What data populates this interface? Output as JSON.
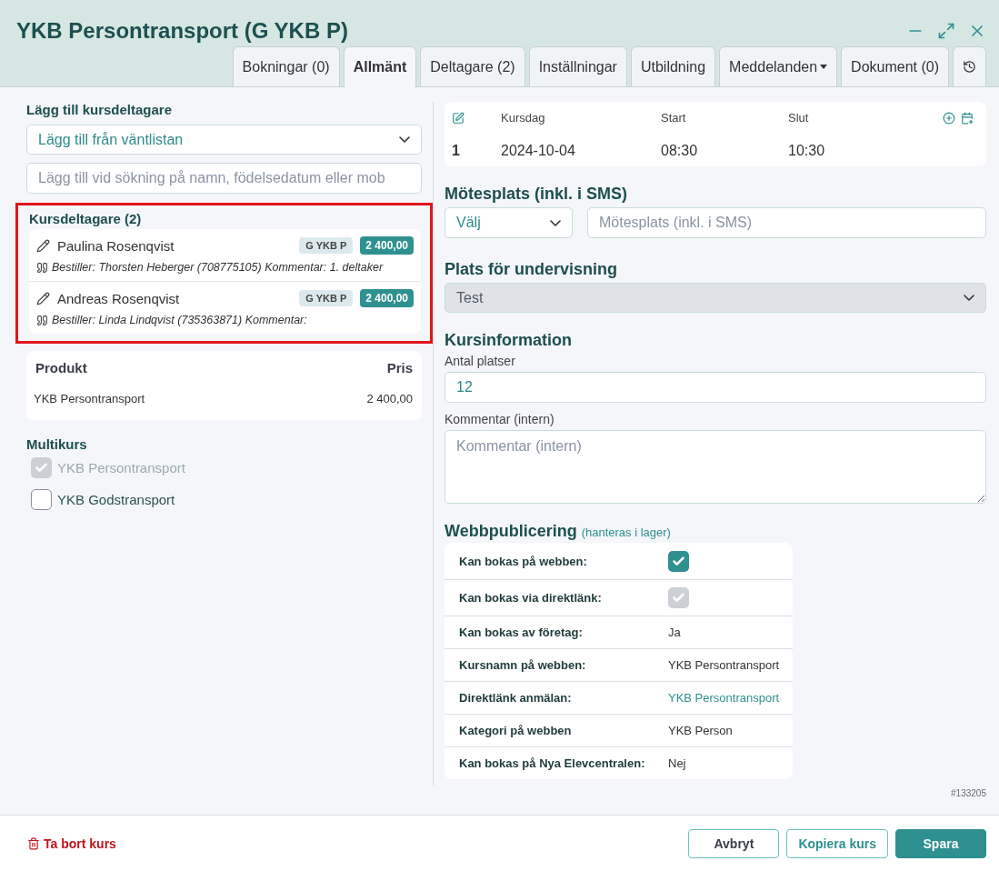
{
  "window": {
    "title": "YKB Persontransport (G YKB P)"
  },
  "tabs": [
    {
      "label": "Bokningar (0)",
      "selected": false,
      "kind": "text"
    },
    {
      "label": "Allmänt",
      "selected": true,
      "kind": "text"
    },
    {
      "label": "Deltagare (2)",
      "selected": false,
      "kind": "text"
    },
    {
      "label": "Inställningar",
      "selected": false,
      "kind": "text"
    },
    {
      "label": "Utbildning",
      "selected": false,
      "kind": "text"
    },
    {
      "label": "Meddelanden",
      "selected": false,
      "kind": "dropdown"
    },
    {
      "label": "Dokument (0)",
      "selected": false,
      "kind": "text"
    },
    {
      "selected": false,
      "kind": "history"
    }
  ],
  "add_participants": {
    "heading": "Lägg till kursdeltagare",
    "waitlist_select": "Lägg till från väntlistan",
    "search": {
      "placeholder": "Lägg till vid sökning på namn, födelsedatum eller mob"
    }
  },
  "participants": {
    "heading": "Kursdeltagare (2)",
    "highlighted": true,
    "items": [
      {
        "name": "Paulina Rosenqvist",
        "code": "G YKB P",
        "price": "2 400,00",
        "details": "Bestiller: Thorsten Heberger (708775105) Kommentar: 1. deltaker"
      },
      {
        "name": "Andreas Rosenqvist",
        "code": "G YKB P",
        "price": "2 400,00",
        "details": "Bestiller: Linda Lindqvist (735363871) Kommentar:"
      }
    ]
  },
  "products": {
    "columns": [
      "Produkt",
      "Pris"
    ],
    "rows": [
      [
        "YKB Persontransport",
        "2 400,00"
      ]
    ]
  },
  "multikurs": {
    "heading": "Multikurs",
    "items": [
      {
        "label": "YKB Persontransport",
        "checked": true,
        "disabled": true
      },
      {
        "label": "YKB Godstransport",
        "checked": false,
        "disabled": false
      }
    ]
  },
  "schedule": {
    "columns": [
      "Kursdag",
      "Start",
      "Slut"
    ],
    "rows": [
      {
        "number": "1",
        "date": "2024-10-04",
        "start": "08:30",
        "end": "10:30"
      }
    ]
  },
  "meeting_place": {
    "heading": "Mötesplats (inkl. i SMS)",
    "select": "Välj",
    "input": {
      "placeholder": "Mötesplats (inkl. i SMS)"
    }
  },
  "teaching_place": {
    "heading": "Plats för undervisning",
    "select": "Test",
    "disabled": true
  },
  "course_info": {
    "heading": "Kursinformation",
    "seats_label": "Antal platser",
    "seats": "12",
    "comment_label": "Kommentar (intern)",
    "comment": {
      "placeholder": "Kommentar (intern)"
    }
  },
  "web_publishing": {
    "heading": "Webbpublicering",
    "note": "(hanteras i lager)",
    "rows": [
      {
        "label": "Kan bokas på webben:",
        "kind": "checkbox",
        "checked": true,
        "disabled": false
      },
      {
        "label": "Kan bokas via direktlänk:",
        "kind": "checkbox",
        "checked": true,
        "disabled": true
      },
      {
        "label": "Kan bokas av företag:",
        "kind": "text",
        "value": "Ja"
      },
      {
        "label": "Kursnamn på webben:",
        "kind": "text",
        "value": "YKB Persontransport"
      },
      {
        "label": "Direktlänk anmälan:",
        "kind": "link",
        "value": "YKB Persontransport"
      },
      {
        "label": "Kategori på webben",
        "kind": "text",
        "value": "YKB Person"
      },
      {
        "label": "Kan bokas på Nya Elevcentralen:",
        "kind": "text",
        "value": "Nej"
      }
    ]
  },
  "record_id": "#133205",
  "footer": {
    "delete": "Ta bort kurs",
    "buttons": [
      {
        "label": "Avbryt",
        "kind": "outline"
      },
      {
        "label": "Kopiera kurs",
        "kind": "outline-accent"
      },
      {
        "label": "Spara",
        "kind": "primary"
      }
    ]
  }
}
